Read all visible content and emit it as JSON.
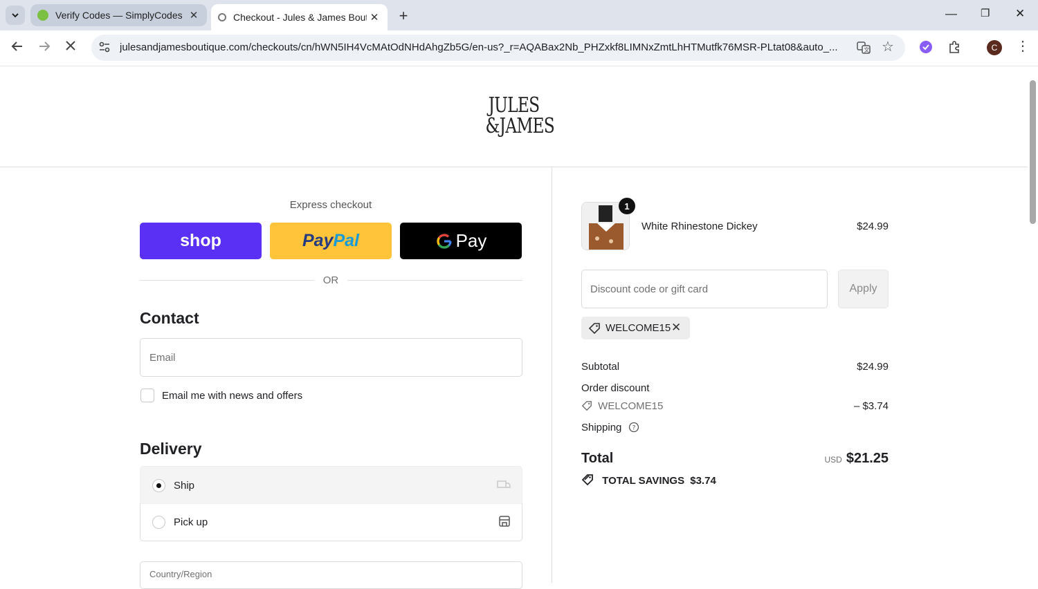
{
  "browser": {
    "tabs": [
      {
        "title": "Verify Codes — SimplyCodes",
        "active": false
      },
      {
        "title": "Checkout - Jules & James Bouti",
        "active": true
      }
    ],
    "url": "julesandjamesboutique.com/checkouts/cn/hWN5IH4VcMAtOdNHdAhgZb5G/en-us?_r=AQABax2Nb_PHZxkf8LIMNxZmtLhHTMutfk76MSR-PLtat08&auto_...",
    "avatar_letter": "C"
  },
  "store": {
    "logo_line1": "JULES",
    "logo_line2": "&JAMES"
  },
  "checkout": {
    "express_title": "Express checkout",
    "shop_label": "shop",
    "paypal_label_a": "Pay",
    "paypal_label_b": "Pal",
    "gpay_label": "Pay",
    "or_label": "OR",
    "contact_heading": "Contact",
    "email_placeholder": "Email",
    "news_label": "Email me with news and offers",
    "delivery_heading": "Delivery",
    "delivery_options": [
      {
        "label": "Ship",
        "selected": true
      },
      {
        "label": "Pick up",
        "selected": false
      }
    ],
    "country_label": "Country/Region"
  },
  "summary": {
    "item": {
      "name": "White Rhinestone Dickey",
      "price": "$24.99",
      "quantity": "1"
    },
    "discount_placeholder": "Discount code or gift card",
    "apply_label": "Apply",
    "applied_code": "WELCOME15",
    "subtotal_label": "Subtotal",
    "subtotal_value": "$24.99",
    "order_discount_label": "Order discount",
    "discount_code": "WELCOME15",
    "discount_value": "– $3.74",
    "shipping_label": "Shipping",
    "total_label": "Total",
    "currency": "USD",
    "total_value": "$21.25",
    "savings_label": "TOTAL SAVINGS",
    "savings_value": "$3.74"
  },
  "colors": {
    "shop": "#5a31f4",
    "paypal": "#ffc439",
    "gpay": "#000000"
  }
}
